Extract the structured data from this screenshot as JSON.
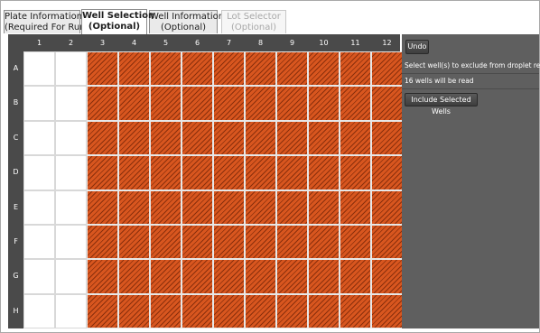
{
  "tabs": [
    {
      "line1": "Plate Information",
      "line2": "(Required For Run)",
      "state": "normal"
    },
    {
      "line1": "Well Selection",
      "line2": "(Optional)",
      "state": "active"
    },
    {
      "line1": "Well Information",
      "line2": "(Optional)",
      "state": "normal"
    },
    {
      "line1": "Lot Selector",
      "line2": "(Optional)",
      "state": "disabled"
    }
  ],
  "plate": {
    "columns": [
      "1",
      "2",
      "3",
      "4",
      "5",
      "6",
      "7",
      "8",
      "9",
      "10",
      "11",
      "12"
    ],
    "rows": [
      "A",
      "B",
      "C",
      "D",
      "E",
      "F",
      "G",
      "H"
    ],
    "empty_columns": [
      "1",
      "2"
    ],
    "excluded_fill_color": "#d8561f",
    "excluded_stripe_color": "#8a2f0c"
  },
  "panel": {
    "undo_label": "Undo",
    "instruction": "Select well(s) to exclude from droplet reading.",
    "wells_read_status": "16 wells will be read",
    "include_button_label": "Include Selected Wells"
  }
}
